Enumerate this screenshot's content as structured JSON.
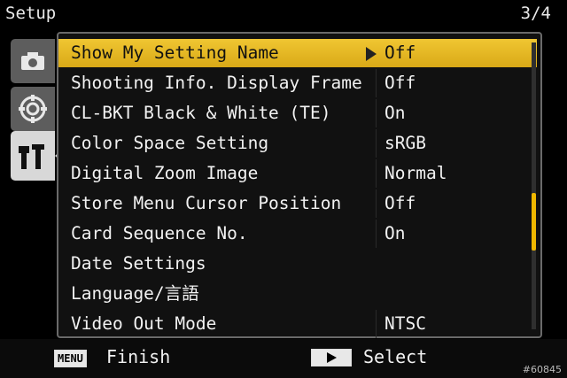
{
  "header": {
    "title": "Setup",
    "page_indicator": "3/4"
  },
  "tabs": [
    {
      "icon": "camera-icon",
      "active": false
    },
    {
      "icon": "dial-icon",
      "active": false
    },
    {
      "icon": "wrench-icon",
      "active": true
    }
  ],
  "menu": {
    "items": [
      {
        "label": "Show My Setting Name",
        "value": "Off"
      },
      {
        "label": "Shooting Info. Display Frame",
        "value": "Off"
      },
      {
        "label": "CL-BKT Black & White (TE)",
        "value": "On"
      },
      {
        "label": "Color Space Setting",
        "value": "sRGB"
      },
      {
        "label": "Digital Zoom Image",
        "value": "Normal"
      },
      {
        "label": "Store Menu Cursor Position",
        "value": "Off"
      },
      {
        "label": "Card Sequence No.",
        "value": "On"
      },
      {
        "label": "Date Settings",
        "value": ""
      },
      {
        "label": "Language/言語",
        "value": ""
      },
      {
        "label": "Video Out Mode",
        "value": "NTSC"
      }
    ],
    "selected_index": 0,
    "scroll_position": 0.53
  },
  "footer": {
    "menu_key": "MENU",
    "finish_label": "Finish",
    "select_label": "Select"
  },
  "watermark": "#60845",
  "colors": {
    "highlight": "#e6b722",
    "scroll_thumb": "#f0b800"
  }
}
